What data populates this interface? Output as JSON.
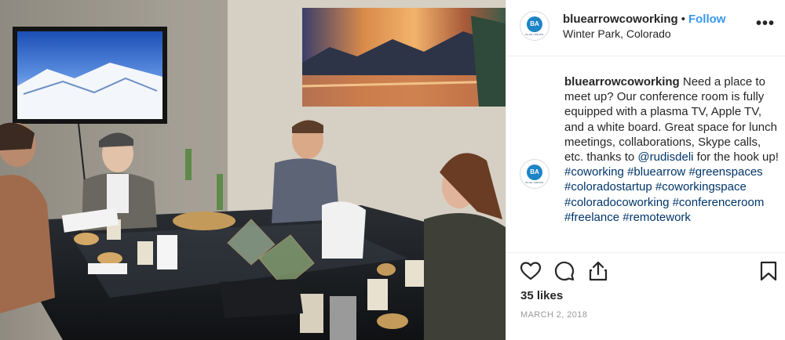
{
  "post": {
    "username": "bluearrowcoworking",
    "separator": "•",
    "follow_label": "Follow",
    "location": "Winter Park, Colorado",
    "more_label": "•••",
    "avatar_initials": "BA",
    "avatar_subtext": "BLUE ARROW"
  },
  "caption": {
    "username": "bluearrowcoworking",
    "text": " Need a place to meet up? Our conference room is fully equipped with a plasma TV, Apple TV, and a white board. Great space for lunch meetings, collaborations, Skype calls, etc. thanks to ",
    "mention": "@rudisdeli",
    "text_after": " for the hook up! ",
    "hashtags": [
      "#coworking",
      "#bluearrow",
      "#greenspaces",
      "#coloradostartup",
      "#coworkingspace",
      "#coloradocoworking",
      "#conferenceroom",
      "#freelance",
      "#remotework"
    ]
  },
  "actions": {
    "like_icon": "heart-icon",
    "comment_icon": "comment-icon",
    "share_icon": "share-icon",
    "save_icon": "bookmark-icon"
  },
  "likes": "35 likes",
  "date": "MARCH 2, 2018",
  "colors": {
    "follow": "#3897f0",
    "hashtag": "#003569",
    "muted": "#999999",
    "border": "#efefef",
    "brand_blue": "#1d84c6"
  }
}
